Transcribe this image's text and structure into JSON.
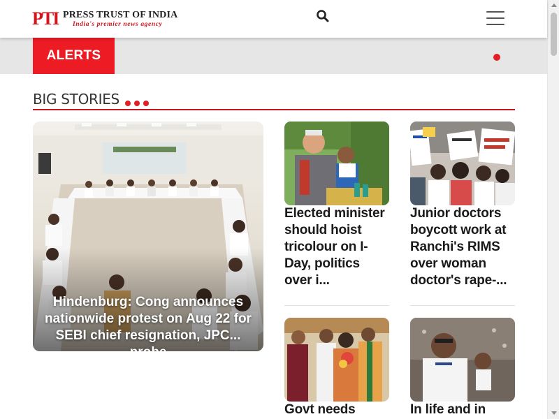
{
  "header": {
    "logo_mark": "PTI",
    "logo_name": "PRESS TRUST OF INDIA",
    "logo_tagline": "India's premier news agency",
    "search_icon": "search-icon",
    "menu_icon": "hamburger-menu-icon"
  },
  "alerts": {
    "label": "ALERTS",
    "accent_color": "#ed1c24"
  },
  "section": {
    "title": "BIG STORIES"
  },
  "feature": {
    "title": "Hindenburg: Cong announces nationwide protest on Aug 22 for SEBI chief resignation, JPC... probe"
  },
  "stories": [
    {
      "title": "Elected minister should hoist tricolour on I-Day, politics over i..."
    },
    {
      "title": "Junior doctors boycott work at Ranchi's RIMS over woman doctor's rape-..."
    },
    {
      "title": "Govt needs"
    },
    {
      "title": "In life and in"
    }
  ]
}
